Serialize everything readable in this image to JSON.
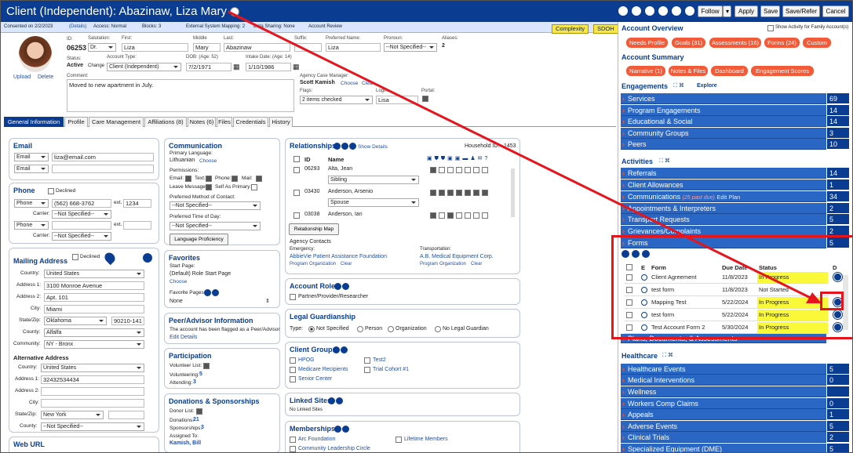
{
  "header": {
    "title": "Client (Independent): Abazinaw, Liza Mary",
    "buttons": [
      "Follow",
      "Apply",
      "Save",
      "Save/Refer",
      "Cancel"
    ]
  },
  "subbar": {
    "consented": "Consented on 2/2/2023",
    "details": "(Details)",
    "access": "Access: Normal",
    "blocks": "Blocks: 3",
    "external": "External System Mapping: 2",
    "sharing": "Data Sharing: None",
    "review": "Account Review",
    "complexity": "Complexity",
    "sdoh": "SDOH"
  },
  "client": {
    "id_label": "ID:",
    "id": "06253",
    "salutation_label": "Salutation:",
    "salutation": "Dr.",
    "first_label": "First:",
    "first": "Liza",
    "middle_label": "Middle",
    "middle": "Mary",
    "last_label": "Last:",
    "last": "Abazinaw",
    "suffix_label": "Suffix:",
    "preferred_label": "Preferred Name:",
    "preferred": "Liza",
    "pronoun_label": "Pronoun:",
    "pronoun": "--Not Specified--",
    "aliases_label": "Aliases:",
    "aliases": "2",
    "status_label": "Status:",
    "status": "Active",
    "change": "Change",
    "account_type_label": "Account Type:",
    "account_type": "Client (Independent)",
    "dob_label": "DOB: (Age: 52)",
    "dob": "7/2/1971",
    "intake_label": "Intake Date: (Age: 14)",
    "intake": "1/10/1986",
    "upload": "Upload",
    "delete": "Delete",
    "comment_label": "Comment:",
    "comment": "Moved to new apartment in July.",
    "case_manager_label": "Agency Case Manager:",
    "case_manager": "Scott Kamish",
    "choose": "Choose",
    "clear": "Clear",
    "flags_label": "Flags:",
    "flags": "2 items checked",
    "login_label": "Login:",
    "login": "Lisa",
    "portal_label": "Portal:"
  },
  "tabs": [
    "General Information",
    "Profile",
    "Care Management",
    "Affiliations (8)",
    "Notes (6)",
    "Files",
    "Credentials",
    "History"
  ],
  "email": {
    "title": "Email",
    "rows": [
      {
        "type": "Email",
        "value": "liza@email.com"
      },
      {
        "type": "Email",
        "value": ""
      }
    ]
  },
  "phone": {
    "title": "Phone",
    "declined": "Declined",
    "rows": [
      {
        "type": "Phone",
        "value": "(562) 668-3762",
        "ext_label": "ext.",
        "ext": "1234",
        "carrier_label": "Carrier:",
        "carrier": "--Not Specified--"
      },
      {
        "type": "Phone",
        "value": "",
        "ext_label": "ext.",
        "ext": "",
        "carrier_label": "Carrier:",
        "carrier": "--Not Specified--"
      }
    ]
  },
  "mailing": {
    "title": "Mailing Address",
    "declined": "Declined",
    "country_label": "Country:",
    "country": "United States",
    "address1_label": "Address 1:",
    "address1": "3100 Monroe Avenue",
    "address2_label": "Address 2:",
    "address2": "Apt. 101",
    "city_label": "City:",
    "city": "Miami",
    "state_label": "State/Zip:",
    "state": "Oklahoma",
    "zip": "90210-141",
    "county_label": "County:",
    "county": "Alfalfa",
    "community_label": "Community:",
    "community": "NY - Bronx",
    "alt_title": "Alternative Address",
    "alt_country": "United States",
    "alt_address1": "32432534434",
    "alt_address2": "",
    "alt_city": "",
    "alt_state": "New York",
    "alt_zip": "",
    "alt_county": "--Not Specified--"
  },
  "web_url": {
    "title": "Web URL"
  },
  "communication": {
    "title": "Communication",
    "primary_label": "Primary Language:",
    "primary": "Lithuanian",
    "choose": "Choose",
    "permissions_label": "Permissions:",
    "email": "Email:",
    "text": "Text:",
    "phone": "Phone:",
    "mail": "Mail:",
    "leave_message": "Leave Message:",
    "self_primary": "Self As Primary:",
    "method_label": "Preferred Method of Contact:",
    "method": "--Not Specified--",
    "time_label": "Preferred Time of Day:",
    "time": "--Not Specified--",
    "lang_button": "Language Proficiency"
  },
  "favorites": {
    "title": "Favorites",
    "start_label": "Start Page:",
    "start": "(Default) Role Start Page",
    "choose": "Choose",
    "pages_label": "Favorite Pages:",
    "pages": "None"
  },
  "peer": {
    "title": "Peer/Advisor Information",
    "text": "The account has been flagged as a Peer/Advisor",
    "edit": "Edit Details"
  },
  "participation": {
    "title": "Participation",
    "volunteer_label": "Volunteer List:",
    "volunteering": "Volunteering:",
    "volunteering_val": "5",
    "attending": "Attending:",
    "attending_val": "3"
  },
  "donations": {
    "title": "Donations & Sponsorships",
    "donor_label": "Donor List:",
    "donations": "Donations:",
    "donations_val": "21",
    "sponsorships": "Sponsorships:",
    "sponsorships_val": "3",
    "assigned": "Assigned To:",
    "assigned_val": "Kamish, Bill"
  },
  "relationships": {
    "title": "Relationships",
    "show": "Show Details",
    "household_label": "Household ID:",
    "household": "1453",
    "col_id": "ID",
    "col_name": "Name",
    "rows": [
      {
        "id": "06293",
        "name": "Alta, Jean",
        "rel": "Sibling"
      },
      {
        "id": "03430",
        "name": "Anderson, Arsenio",
        "rel": "Spouse"
      },
      {
        "id": "03038",
        "name": "Anderson, Ian",
        "rel": ""
      }
    ],
    "map": "Relationship Map",
    "agency_contacts": "Agency Contacts",
    "emergency_label": "Emergency:",
    "emergency": "AbbieVie Patient Assistance Foundation",
    "transport_label": "Transportation:",
    "transport": "A.B. Medical Equipment Corp.",
    "sub_links": [
      "Program",
      "Organization",
      "Clear"
    ]
  },
  "account_roles": {
    "title": "Account Roles",
    "items": [
      "Partner/Provider/Researcher"
    ]
  },
  "legal": {
    "title": "Legal Guardianship",
    "type_label": "Type:",
    "options": [
      "Not Specified",
      "Person",
      "Organization",
      "No Legal Guardian"
    ]
  },
  "client_groups": {
    "title": "Client Groups",
    "items": [
      "HPOG",
      "Test2",
      "Medicare Recipients",
      "Trial Cohort #1",
      "Senior Center"
    ]
  },
  "linked_sites": {
    "title": "Linked Sites",
    "text": "No Linked Sites"
  },
  "memberships": {
    "title": "Memberships",
    "items": [
      "Arc Foundation",
      "Lifetime Members",
      "Community Leadership Circle"
    ]
  },
  "right": {
    "overview_title": "Account Overview",
    "family_label": "Show Activity for Family Account(s)",
    "overview_pills": [
      "Needs Profile",
      "Goals (31)",
      "Assessments (16)",
      "Forms (24)",
      "Custom"
    ],
    "summary_title": "Account Summary",
    "summary_pills": [
      "Narrative (1)",
      "Notes & Files",
      "Dashboard",
      "Engagement Scores"
    ],
    "engagements_title": "Engagements",
    "explore": "Explore",
    "engagements": [
      {
        "label": "Services",
        "n": "69"
      },
      {
        "label": "Program Engagements",
        "n": "14"
      },
      {
        "label": "Educational & Social",
        "n": "14"
      },
      {
        "label": "Community Groups",
        "n": "3"
      },
      {
        "label": "Peers",
        "n": "10"
      }
    ],
    "activities_title": "Activities",
    "activities": [
      {
        "label": "Referrals",
        "n": "14"
      },
      {
        "label": "Client Allowances",
        "n": "1"
      },
      {
        "label": "Communications",
        "n": "34",
        "note": "(25 past due)",
        "link": "Edit Plan"
      },
      {
        "label": "Appointments & Interpreters",
        "n": "2"
      },
      {
        "label": "Transport Requests",
        "n": "5"
      },
      {
        "label": "Grievances/Complaints",
        "n": "2"
      },
      {
        "label": "Forms",
        "n": "5"
      }
    ],
    "forms_cols": {
      "e": "E",
      "form": "Form",
      "due": "Due Date",
      "status": "Status",
      "d": "D"
    },
    "forms": [
      {
        "form": "Client Agreement",
        "due": "11/8/2023",
        "status": "In Progress"
      },
      {
        "form": "test form",
        "due": "11/8/2023",
        "status": "Not Started"
      },
      {
        "form": "Mapping Test",
        "due": "5/22/2024",
        "status": "In Progress"
      },
      {
        "form": "test form",
        "due": "5/22/2024",
        "status": "In Progress"
      },
      {
        "form": "Test Account Form 2",
        "due": "5/30/2024",
        "status": "In Progress"
      }
    ],
    "plans": "Plans, Documents, & Assessments",
    "healthcare_title": "Healthcare",
    "healthcare": [
      {
        "label": "Healthcare Events",
        "n": "5"
      },
      {
        "label": "Medical Interventions",
        "n": "0"
      },
      {
        "label": "Wellness",
        "n": ""
      },
      {
        "label": "Workers Comp Claims",
        "n": "0"
      },
      {
        "label": "Appeals",
        "n": "1"
      },
      {
        "label": "Adverse Events",
        "n": "5"
      },
      {
        "label": "Clinical Trials",
        "n": "2"
      },
      {
        "label": "Specialized Equipment (DME)",
        "n": "5"
      }
    ]
  },
  "colors": {
    "header": "#0a3d91",
    "row": "#2a66c4",
    "pill": "#f35a38",
    "highlight": "#f9f93a",
    "annotation": "#e8141c"
  }
}
